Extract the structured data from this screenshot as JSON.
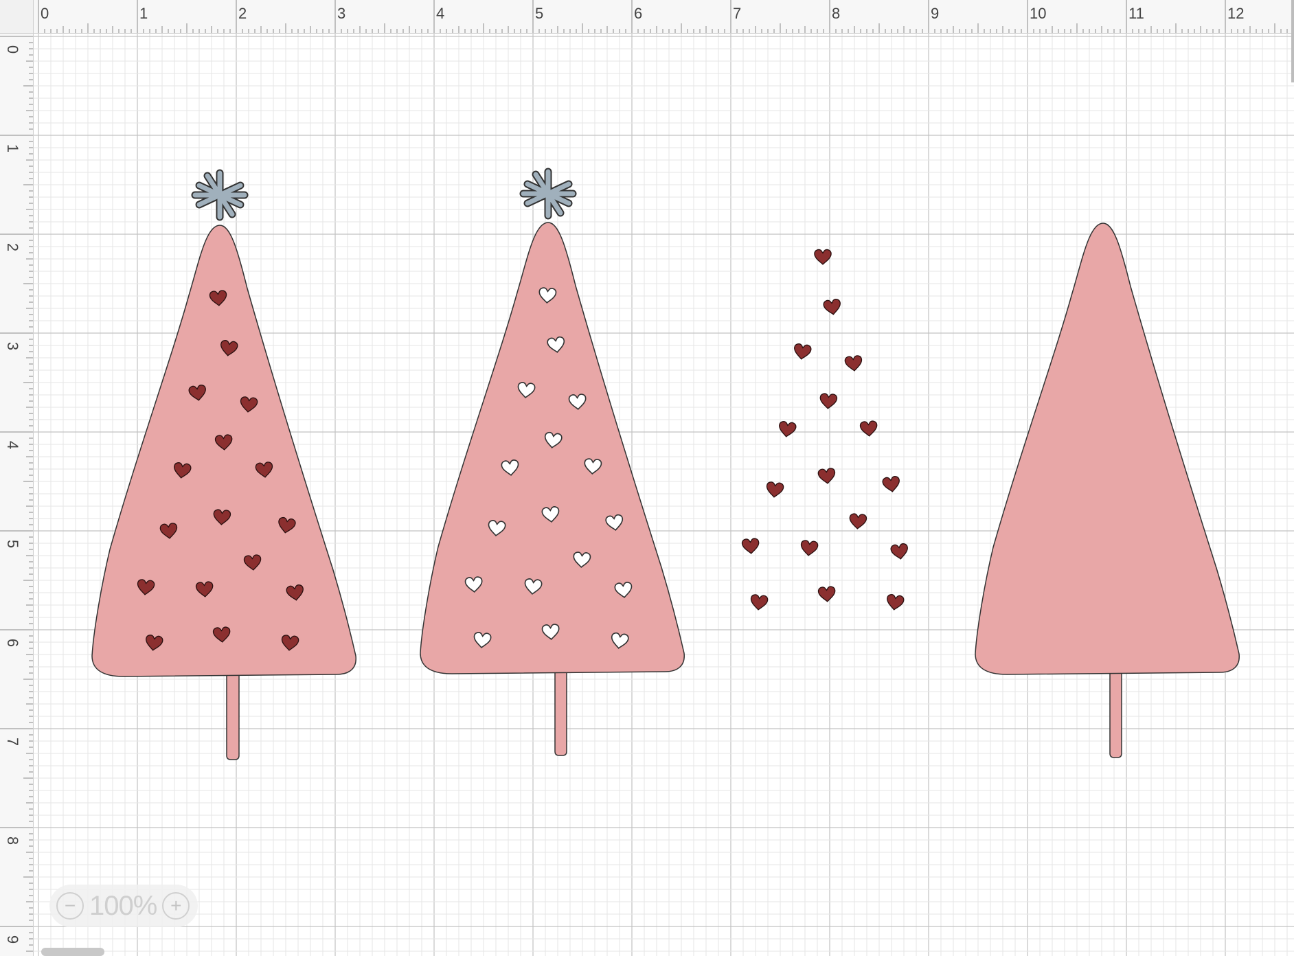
{
  "ruler": {
    "unit": "in",
    "top_labels": [
      "0",
      "1",
      "2",
      "3",
      "4",
      "5",
      "6",
      "7",
      "8",
      "9",
      "10",
      "11",
      "12"
    ],
    "left_labels": [
      "0",
      "1",
      "2",
      "3",
      "4",
      "5",
      "6",
      "7",
      "8",
      "9"
    ]
  },
  "zoom": {
    "label": "100%",
    "minus": "−",
    "plus": "+"
  },
  "colors": {
    "tree_fill": "#e8a7a7",
    "outline": "#333333",
    "heart_red": "#8b2f2f",
    "heart_white": "#ffffff",
    "star": "#a0b0bc",
    "grid_minor": "#e6e6e6",
    "grid_major": "#c2c2c2"
  },
  "canvas_items": [
    {
      "name": "tree-1-red-hearts",
      "star": true,
      "hearts": "red"
    },
    {
      "name": "tree-2-white-hearts",
      "star": true,
      "hearts": "white"
    },
    {
      "name": "heart-cluster",
      "hearts": "red"
    },
    {
      "name": "tree-4-plain",
      "star": false,
      "hearts": "none"
    }
  ]
}
